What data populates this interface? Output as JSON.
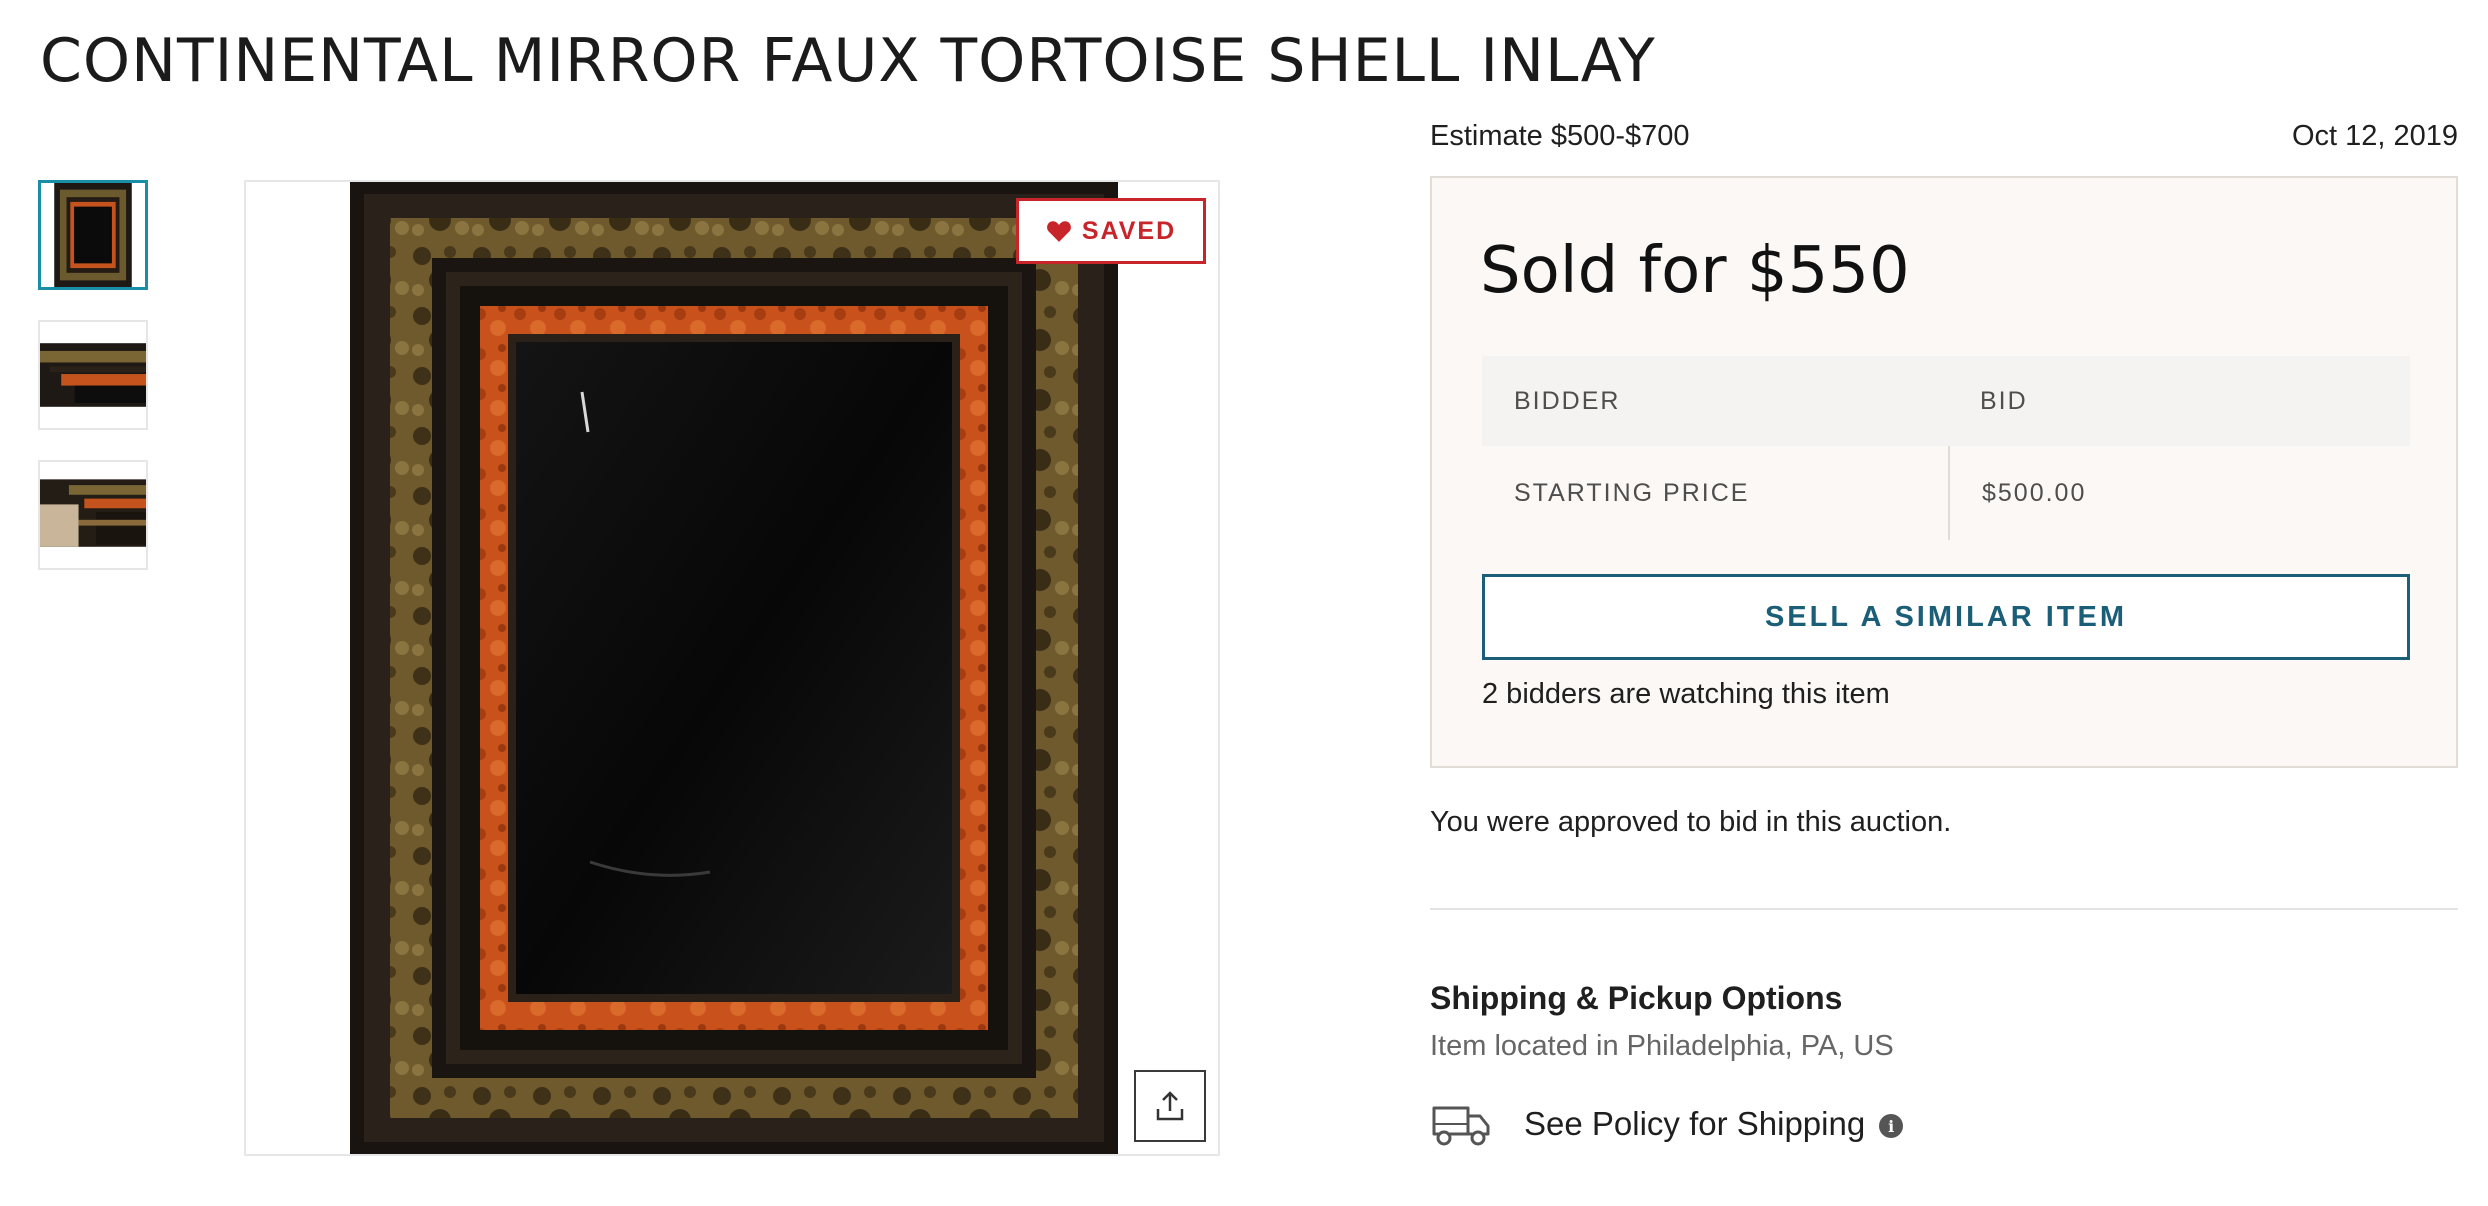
{
  "item": {
    "title": "CONTINENTAL MIRROR FAUX TORTOISE SHELL INLAY",
    "estimate": "Estimate $500-$700",
    "date": "Oct 12, 2019"
  },
  "gallery": {
    "saved_label": "SAVED",
    "thumbnail_count": 3,
    "active_thumbnail": 1
  },
  "sale": {
    "sold_label": "Sold for $550",
    "table": {
      "headers": [
        "BIDDER",
        "BID"
      ],
      "rows": [
        {
          "bidder": "STARTING PRICE",
          "bid": "$500.00"
        }
      ]
    },
    "similar_button": "SELL A SIMILAR ITEM",
    "watching_text": "2 bidders are watching this item"
  },
  "approval_text": "You were approved to bid in this auction.",
  "shipping": {
    "heading": "Shipping & Pickup Options",
    "location": "Item located in Philadelphia, PA, US",
    "policy_link": "See Policy for Shipping"
  },
  "colors": {
    "accent_teal": "#1b8ea7",
    "button_blue": "#1b5e78",
    "saved_red": "#c8252b",
    "panel_bg": "#fcf8f5"
  },
  "icons": [
    "heart-icon",
    "share-icon",
    "truck-icon",
    "info-icon"
  ]
}
